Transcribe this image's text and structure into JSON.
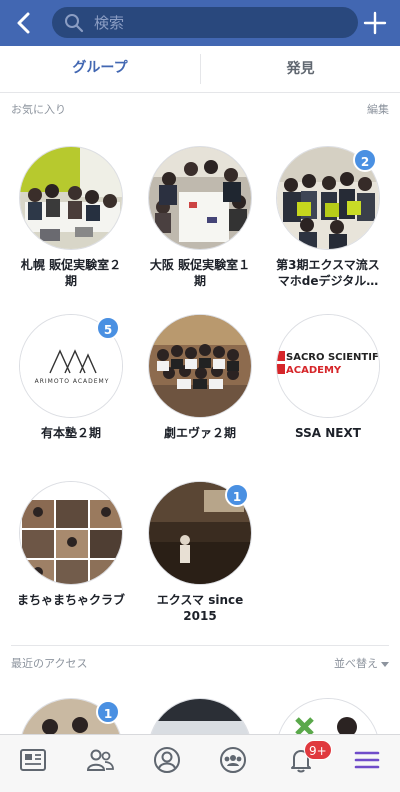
{
  "search": {
    "placeholder": "検索"
  },
  "tabs": [
    {
      "label": "グループ",
      "active": true
    },
    {
      "label": "発見",
      "active": false
    }
  ],
  "favorites": {
    "title": "お気に入り",
    "edit_label": "編集",
    "groups": [
      {
        "name": "札幌 販促実験室２期",
        "badge": ""
      },
      {
        "name": "大阪 販促実験室１期",
        "badge": ""
      },
      {
        "name": "第3期エクスマ流スマホdeデジタル…",
        "badge": "2"
      },
      {
        "name": "有本塾２期",
        "badge": "5",
        "logo_text": "ARIMOTO ACADEMY"
      },
      {
        "name": "劇エヴァ２期",
        "badge": ""
      },
      {
        "name": "SSA NEXT",
        "badge": "",
        "logo_text_1": "SACRO SCIENTIFIC",
        "logo_text_2": "ACADEMY"
      },
      {
        "name": "まちゃまちゃクラブ",
        "badge": ""
      },
      {
        "name": "エクスマ since 2015",
        "badge": "1"
      }
    ]
  },
  "recent": {
    "title": "最近のアクセス",
    "sort_label": "並べ替え",
    "first_badge": "1"
  },
  "bottom_nav": {
    "notification_count": "9+"
  },
  "colors": {
    "brand": "#4267b2",
    "badge_blue": "#4a90e2",
    "notification_red": "#e0393e",
    "menu_purple": "#6f4cc9"
  }
}
